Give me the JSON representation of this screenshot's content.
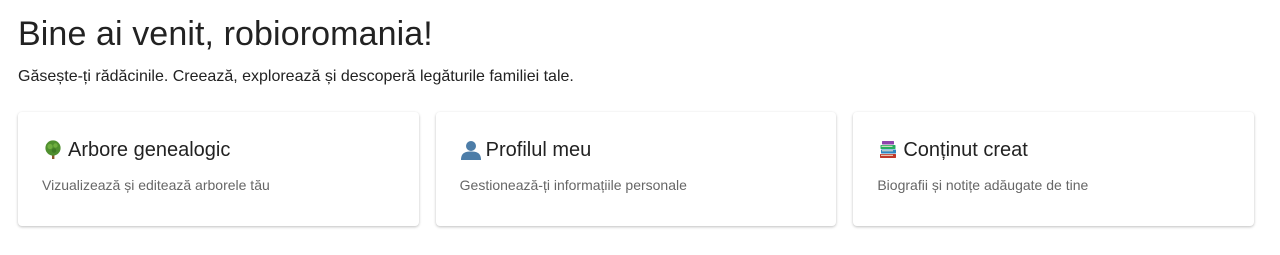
{
  "header": {
    "title": "Bine ai venit, robioromania!",
    "subtitle": "Găsește-ți rădăcinile. Creează, explorează și descoperă legăturile familiei tale."
  },
  "cards": [
    {
      "icon": "tree-icon",
      "title": "Arbore genealogic",
      "description": "Vizualizează și editează arborele tău"
    },
    {
      "icon": "user-silhouette-icon",
      "title": "Profilul meu",
      "description": "Gestionează-ți informațiile personale"
    },
    {
      "icon": "books-icon",
      "title": "Conținut creat",
      "description": "Biografii și notițe adăugate de tine"
    }
  ]
}
